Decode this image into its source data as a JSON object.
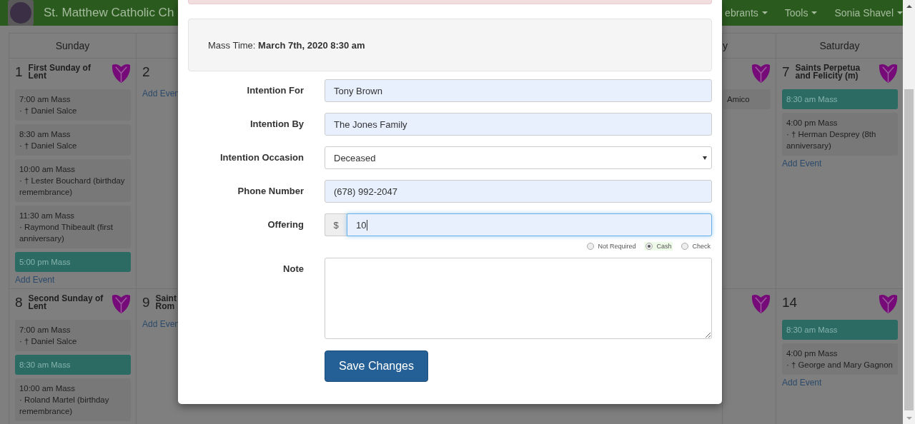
{
  "navbar": {
    "brand": "St. Matthew Catholic Ch",
    "menus": [
      {
        "label": "ebrants"
      },
      {
        "label": "Tools"
      },
      {
        "label": "Sonia Shavel"
      }
    ]
  },
  "calendar": {
    "left_columns": [
      {
        "heading": "Sunday",
        "weeks": [
          {
            "day": "1",
            "title": "First Sunday of Lent",
            "vestment": true,
            "events": [
              {
                "time": "7:00 am Mass",
                "intention": "· † Daniel Salce",
                "highlighted": false
              },
              {
                "time": "8:30 am Mass",
                "intention": "· † Daniel Salce",
                "highlighted": false
              },
              {
                "time": "10:00 am Mass",
                "intention": "· † Lester Bouchard (birthday remembrance)",
                "highlighted": false
              },
              {
                "time": "11:30 am Mass",
                "intention": "· Raymond Thibeault (first anniversary)",
                "highlighted": false
              },
              {
                "time": "5:00 pm Mass",
                "highlighted": true
              }
            ],
            "add_link": "Add Event"
          },
          {
            "day": "8",
            "title": "Second Sunday of Lent",
            "vestment": true,
            "events": [
              {
                "time": "7:00 am Mass",
                "intention": "· † Daniel Salce",
                "highlighted": false
              },
              {
                "time": "8:30 am Mass",
                "highlighted": true
              },
              {
                "time": "10:00 am Mass",
                "intention": "· Roland Martel (birthday remembrance)",
                "highlighted": false
              }
            ]
          }
        ]
      },
      {
        "weeks": [
          {
            "day": "2",
            "vestment": false,
            "add_link": "Add Even"
          },
          {
            "day": "9",
            "title": "Saint Rom",
            "vestment": false,
            "add_link": "Add Even"
          }
        ]
      }
    ],
    "right_columns": [
      {
        "heading": "y",
        "weeks": [
          {
            "vestment": true,
            "events": [
              {
                "intention": "Amico",
                "highlighted": false
              }
            ]
          },
          {
            "vestment": true
          }
        ]
      },
      {
        "heading": "Saturday",
        "weeks": [
          {
            "day": "7",
            "title": "Saints Perpetua and Felicity (m)",
            "vestment": true,
            "events": [
              {
                "time": "8:30 am Mass",
                "highlighted": true
              },
              {
                "time": "4:00 pm Mass",
                "intention": "· † Herman Desprey (8th anniversary)",
                "highlighted": false
              }
            ],
            "add_link": "Add Event"
          },
          {
            "day": "14",
            "vestment": true,
            "events": [
              {
                "time": "8:30 am Mass",
                "highlighted": true
              },
              {
                "time": "4:00 pm Mass",
                "intention": "· † George and Mary Gagnon",
                "highlighted": false
              }
            ],
            "add_link": "Add Event"
          }
        ]
      }
    ]
  },
  "modal": {
    "mass_time": "Mass Time: **March 7th, 2020 8:30 am**",
    "fields": [
      {
        "label": "Intention For",
        "kind": "text",
        "value": "Tony Brown",
        "focused": false
      },
      {
        "label": "Intention By",
        "kind": "text",
        "value": "The Jones Family",
        "focused": false
      },
      {
        "label": "Intention Occasion",
        "kind": "select",
        "value": "Deceased",
        "focused": false
      },
      {
        "label": "Phone Number",
        "kind": "text",
        "value": "(678) 992-2047",
        "focused": false
      },
      {
        "label": "Offering",
        "kind": "money",
        "prefix": "$",
        "value": "10",
        "focused": true,
        "payment": [
          {
            "label": "Not Required",
            "selected": false
          },
          {
            "label": "Cash",
            "selected": true
          },
          {
            "label": "Check",
            "selected": false
          }
        ]
      },
      {
        "label": "Note",
        "kind": "textarea",
        "focused": false
      }
    ],
    "save_button": "Save Changes"
  }
}
